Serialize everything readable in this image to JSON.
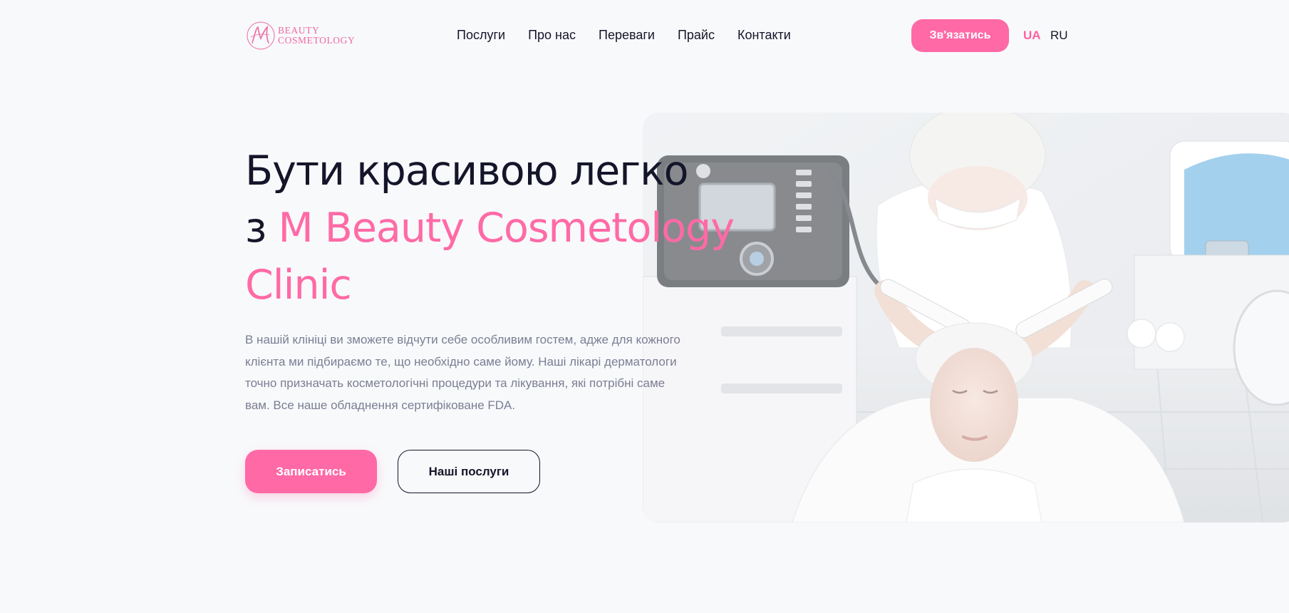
{
  "brand": {
    "logo_line1": "BEAUTY",
    "logo_line2": "COSMETOLOGY",
    "accent_color": "#ff69a6"
  },
  "nav": {
    "items": [
      {
        "label": "Послуги"
      },
      {
        "label": "Про нас"
      },
      {
        "label": "Переваги"
      },
      {
        "label": "Прайс"
      },
      {
        "label": "Контакти"
      }
    ]
  },
  "header": {
    "contact_button": "Зв'язатись",
    "languages": [
      {
        "code": "UA",
        "active": true
      },
      {
        "code": "RU",
        "active": false
      }
    ]
  },
  "hero": {
    "title_part1": "Бути красивою легко",
    "title_part2": "з ",
    "title_accent": "M Beauty Cosmetology Clinic",
    "description": "В нашій клініці ви зможете відчути себе особливим гостем, адже для кожного клієнта ми підбираємо те, що необхідно саме йому. Наші лікарі дерматологи точно призначать косметологічні процедури та лікування, які потрібні саме вам. Все наше обладнення сертифіковане FDA.",
    "primary_button": "Записатись",
    "secondary_button": "Наші послуги",
    "image_icon": "cosmetology-procedure-photo"
  }
}
